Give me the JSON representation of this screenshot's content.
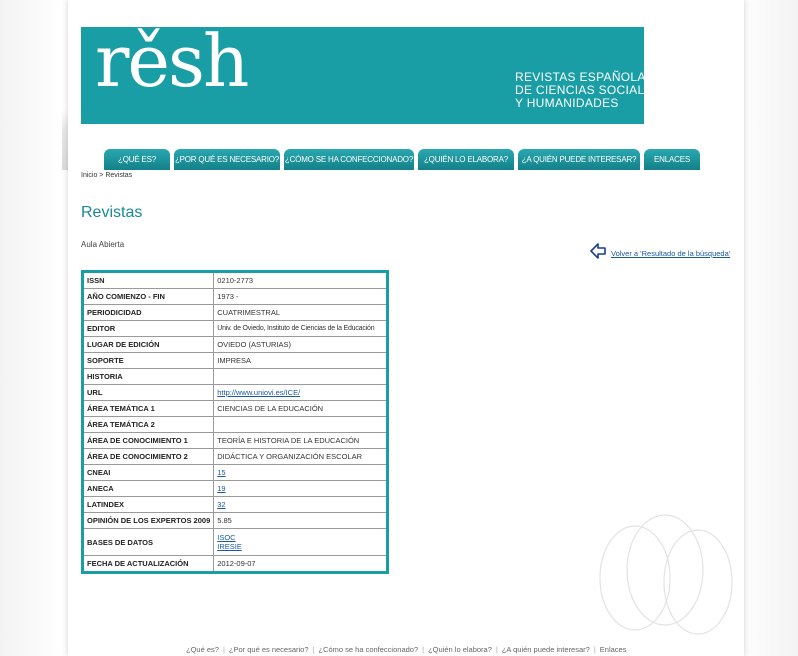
{
  "header": {
    "logo_text": "rěsh",
    "tagline": [
      "REVISTAS ESPAÑOLAS",
      "DE CIENCIAS SOCIALES",
      "Y HUMANIDADES"
    ],
    "brand_color": "#1a9ea6"
  },
  "nav": {
    "tabs": [
      {
        "label": "¿QUÉ ES?"
      },
      {
        "label": "¿POR QUÉ ES NECESARIO?"
      },
      {
        "label": "¿CÓMO SE HA CONFECCIONADO?"
      },
      {
        "label": "¿QUIÉN LO ELABORA?"
      },
      {
        "label": "¿A QUIÉN PUEDE INTERESAR?"
      },
      {
        "label": "ENLACES"
      }
    ]
  },
  "breadcrumb": "Inicio > Revistas",
  "page_title": "Revistas",
  "journal_name": "Aula Abierta",
  "back_link": {
    "label": "Volver a 'Resultado de la búsqueda'",
    "icon": "back-arrow-icon"
  },
  "table": {
    "rows": [
      {
        "label": "ISSN",
        "value": "0210-2773"
      },
      {
        "label": "AÑO COMIENZO - FIN",
        "value": "1973 -"
      },
      {
        "label": "PERIODICIDAD",
        "value": "CUATRIMESTRAL"
      },
      {
        "label": "EDITOR",
        "value": "Univ. de Oviedo, Instituto de Ciencias de la Educación"
      },
      {
        "label": "LUGAR DE EDICIÓN",
        "value": "OVIEDO (ASTURIAS)"
      },
      {
        "label": "SOPORTE",
        "value": "IMPRESA"
      },
      {
        "label": "HISTORIA",
        "value": ""
      },
      {
        "label": "URL",
        "value": "http://www.uniovi.es/ICE/"
      },
      {
        "label": "ÁREA TEMÁTICA 1",
        "value": "CIENCIAS DE LA EDUCACIÓN"
      },
      {
        "label": "ÁREA TEMÁTICA 2",
        "value": ""
      },
      {
        "label": "ÁREA DE CONOCIMIENTO 1",
        "value": "TEORÍA E HISTORIA DE LA EDUCACIÓN"
      },
      {
        "label": "ÁREA DE CONOCIMIENTO 2",
        "value": "DIDÁCTICA Y ORGANIZACIÓN ESCOLAR"
      },
      {
        "label": "CNEAI",
        "value": "15"
      },
      {
        "label": "ANECA",
        "value": "19"
      },
      {
        "label": "LATINDEX",
        "value": "32"
      },
      {
        "label": "OPINIÓN DE LOS EXPERTOS 2009",
        "value": "5.85"
      },
      {
        "label": "BASES DE DATOS",
        "value_1": "ISOC",
        "value_2": "IRESIE"
      },
      {
        "label": "FECHA DE ACTUALIZACIÓN",
        "value": "2012-09-07"
      }
    ]
  },
  "footer": {
    "links": [
      "¿Qué es?",
      "¿Por qué es necesario?",
      "¿Cómo se ha confeccionado?",
      "¿Quién lo elabora?",
      "¿A quién puede interesar?",
      "Enlaces"
    ]
  }
}
